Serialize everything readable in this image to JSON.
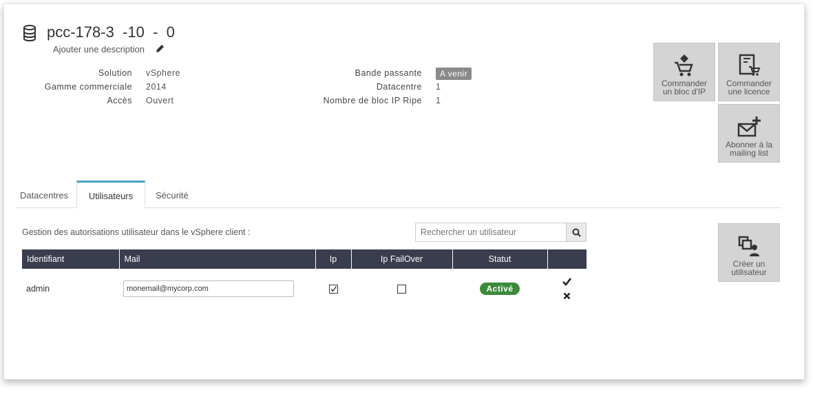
{
  "header": {
    "title": "pcc-178-3  -10  -  0",
    "description_link": "Ajouter une description"
  },
  "info_left": [
    {
      "label": "Solution",
      "value": "vSphere"
    },
    {
      "label": "Gamme commerciale",
      "value": "2014"
    },
    {
      "label": "Accès",
      "value": "Ouvert"
    }
  ],
  "info_right": [
    {
      "label": "Bande passante",
      "value": "A venir"
    },
    {
      "label": "Datacentre",
      "value": "1"
    },
    {
      "label": "Nombre de bloc IP Ripe",
      "value": "1"
    }
  ],
  "actions": {
    "order_ip": [
      "Commander",
      "un bloc d'IP"
    ],
    "order_license": [
      "Commander",
      "une licence"
    ],
    "mailing": [
      "Abonner à la",
      "mailing list"
    ],
    "create_user": [
      "Créer un",
      "utilisateur"
    ]
  },
  "tabs": [
    "Datacentres",
    "Utilisateurs",
    "Sécurité"
  ],
  "users_panel": {
    "description": "Gestion des autorisations utilisateur dans le vSphere client :",
    "search_placeholder": "Rechercher un utilisateur",
    "columns": [
      "Identifiant",
      "Mail",
      "Ip",
      "Ip FailOver",
      "Statut",
      ""
    ],
    "rows": [
      {
        "id": "admin",
        "mail": "monemail@mycorp.com",
        "ip": true,
        "ip_failover": false,
        "status": "Activé"
      }
    ]
  },
  "colors": {
    "header_row": "#393d4d",
    "active_tab": "#46a2c0",
    "status_active": "#3b8a3b",
    "tile_bg": "#d4d4d4",
    "badge_grey": "#8a8a8a"
  }
}
